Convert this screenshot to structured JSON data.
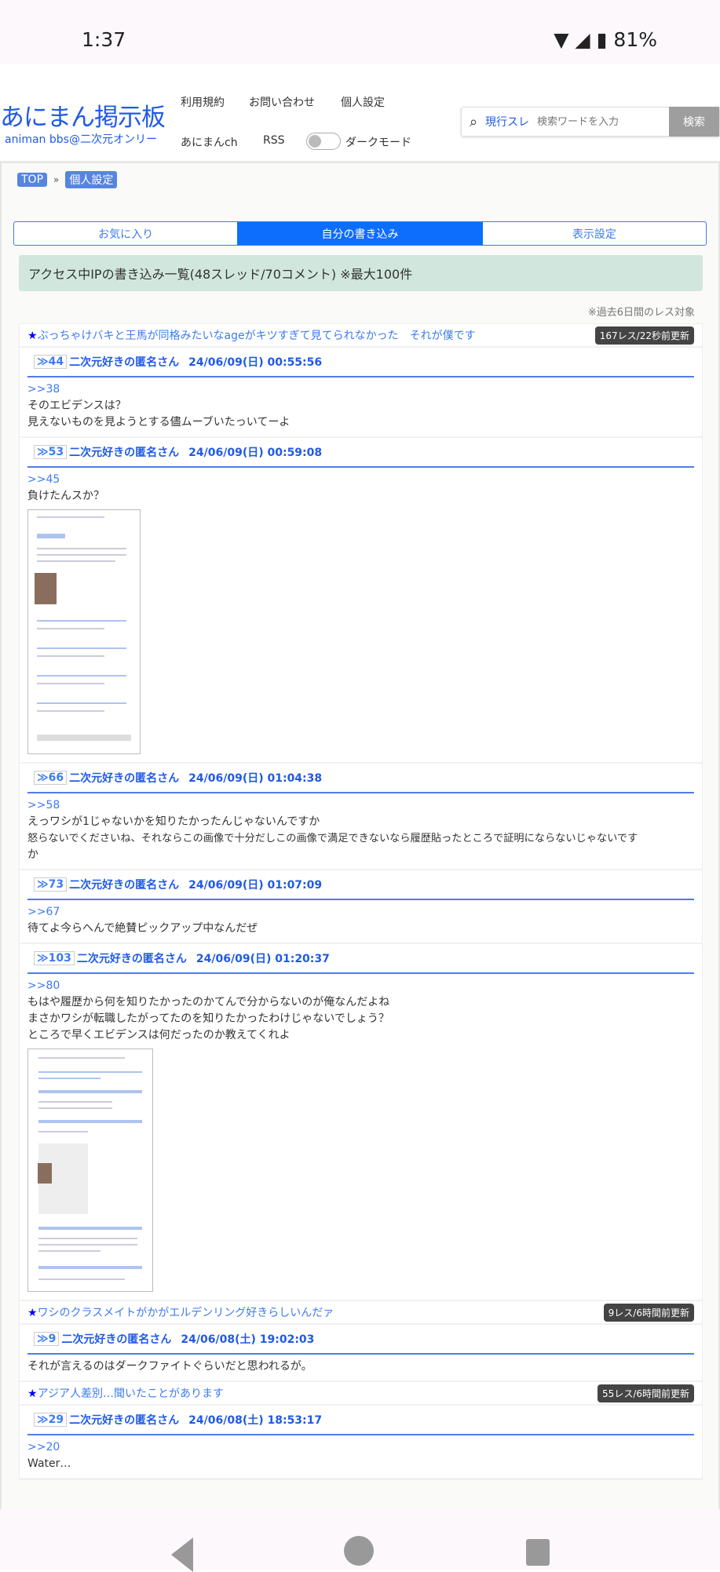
{
  "status_bar": {
    "time": "1:37",
    "battery": "81%"
  },
  "header": {
    "logo_title": "あにまん掲示板",
    "logo_subtitle": "animan bbs@二次元オンリー",
    "menu": [
      "利用規約",
      "お問い合わせ",
      "個人設定",
      "あにまんch",
      "RSS"
    ],
    "dark_mode_label": "ダークモード",
    "search_scope": "現行スレ",
    "search_placeholder": "検索ワードを入力",
    "search_button": "検索"
  },
  "breadcrumb": [
    "TOP",
    "»",
    "個人設定"
  ],
  "tabs": [
    "お気に入り",
    "自分の書き込み",
    "表示設定"
  ],
  "info": "アクセス中IPの書き込み一覧(48スレッド/70コメント) ※最大100件",
  "note": "※過去6日間のレス対象",
  "threads": [
    {
      "star": "★",
      "title": "ぶっちゃけバキと王馬が同格みたいなageがキツすぎて見てられなかった　それが僕です",
      "badge": "167レス/22秒前更新",
      "posts": [
        {
          "no": "≫44",
          "name": "二次元好きの匿名さん",
          "date": "24/06/09(日) 00:55:56",
          "ref": ">>38",
          "lines": [
            "そのエビデンスは？",
            "見えないものを見ようとする儘ムーブいたっいてーよ"
          ]
        },
        {
          "no": "≫53",
          "name": "二次元好きの匿名さん",
          "date": "24/06/09(日) 00:59:08",
          "ref": ">>45",
          "lines": [
            "負けたんスか？"
          ]
        },
        {
          "no": "≫66",
          "name": "二次元好きの匿名さん",
          "date": "24/06/09(日) 01:04:38",
          "ref": ">>58",
          "lines": [
            "えっワシが1じゃないかを知りたかったんじゃないんですか",
            "怒らないでくださいね、それならこの画像で十分だしこの画像で満足できないなら履歴貼ったところで証明にならないじゃないです",
            "か"
          ]
        },
        {
          "no": "≫73",
          "name": "二次元好きの匿名さん",
          "date": "24/06/09(日) 01:07:09",
          "ref": ">>67",
          "lines": [
            "待てよ今らへんで絶賛ピックアップ中なんだぜ"
          ]
        },
        {
          "no": "≫103",
          "name": "二次元好きの匿名さん",
          "date": "24/06/09(日) 01:20:37",
          "ref": ">>80",
          "lines": [
            "もはや履歴から何を知りたかったのかてんで分からないのが俺なんだよね",
            "まさかワシが転職したがってたのを知りたかったわけじゃないでしょう？",
            "ところで早くエビデンスは何だったのか教えてくれよ"
          ]
        }
      ]
    },
    {
      "star": "★",
      "title": "ワシのクラスメイトがかがエルデンリング好きらしいんだァ",
      "badge": "9レス/6時間前更新",
      "posts": [
        {
          "no": "≫9",
          "name": "二次元好きの匿名さん",
          "date": "24/06/08(土) 19:02:03",
          "lines": [
            "それが言えるのはダークファイトぐらいだと思われるが。"
          ]
        }
      ]
    },
    {
      "star": "★",
      "title": "アジア人差別…聞いたことがあります",
      "badge": "55レス/6時間前更新",
      "posts": [
        {
          "no": "≫29",
          "name": "二次元好きの匿名さん",
          "date": "24/06/08(土) 18:53:17",
          "ref": ">>20",
          "lines": [
            "Water…"
          ]
        }
      ]
    }
  ]
}
